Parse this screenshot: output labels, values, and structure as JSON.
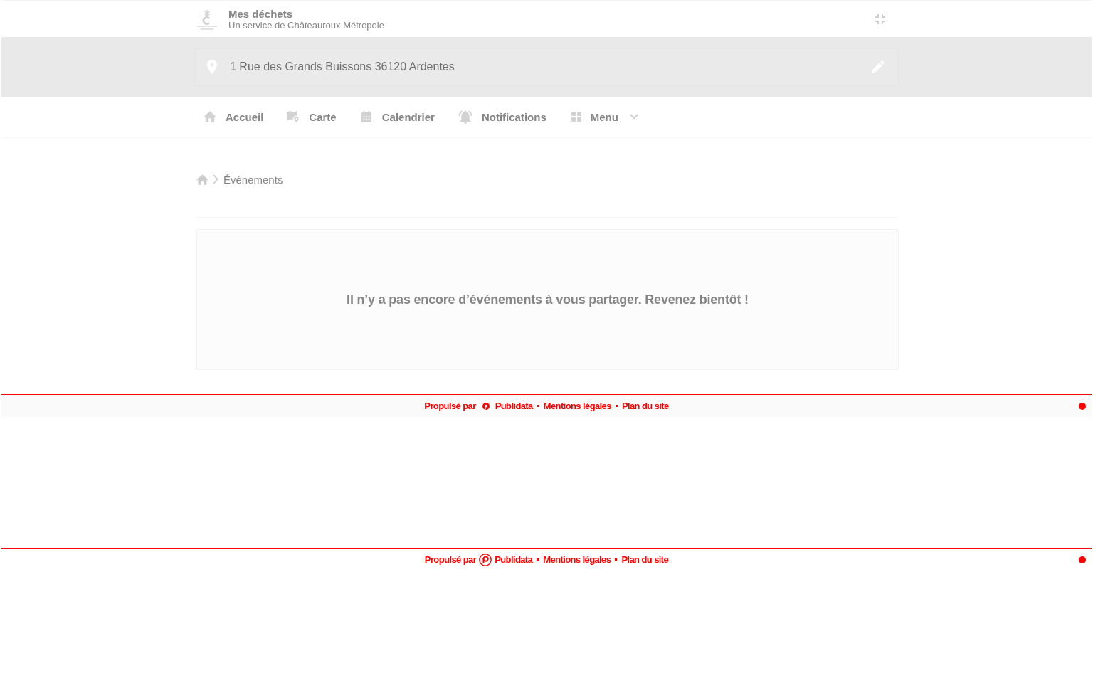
{
  "header": {
    "title": "Mes déchets",
    "subtitle": "Un service de Châteauroux Métropole"
  },
  "address": {
    "value": "1 Rue des Grands Buissons 36120 Ardentes"
  },
  "nav": [
    {
      "label": "Accueil",
      "kind": "link",
      "selected": false
    },
    {
      "label": "Carte",
      "kind": "link",
      "selected": false
    },
    {
      "label": "Calendrier",
      "kind": "link",
      "selected": false
    },
    {
      "label": "Notifications",
      "kind": "link",
      "selected": false
    },
    {
      "label": "Menu",
      "kind": "dropdown",
      "selected": false
    }
  ],
  "breadcrumb": {
    "current": "Événements"
  },
  "empty_state": {
    "message": "Il n’y a pas encore d’événements à vous partager. Revenez bientôt !"
  },
  "footers": [
    {
      "kind": "shaded",
      "powered_by": "Propulsé par",
      "brand": "Publidata",
      "links": [
        "Mentions légales",
        "Plan du site"
      ]
    },
    {
      "kind": "plain",
      "powered_by": "Propulsé par",
      "brand": "Publidata",
      "links": [
        "Mentions légales",
        "Plan du site"
      ]
    }
  ]
}
